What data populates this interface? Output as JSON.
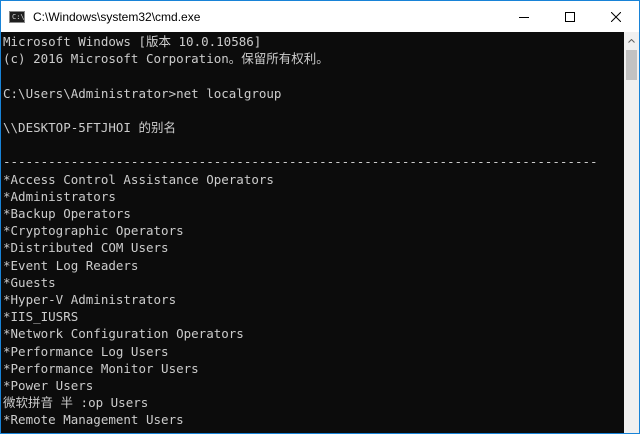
{
  "window": {
    "title": "C:\\Windows\\system32\\cmd.exe",
    "icon_label": "C:\\",
    "controls": [
      "minimize-icon",
      "maximize-icon",
      "close-icon"
    ],
    "border_color": "#1883d7"
  },
  "console": {
    "background": "#0c0c0c",
    "foreground": "#cccccc",
    "lines": [
      "Microsoft Windows [版本 10.0.10586]",
      "(c) 2016 Microsoft Corporation。保留所有权利。",
      "",
      "C:\\Users\\Administrator>net localgroup",
      "",
      "\\\\DESKTOP-5FTJHOI 的别名",
      "",
      "-------------------------------------------------------------------------------",
      "*Access Control Assistance Operators",
      "*Administrators",
      "*Backup Operators",
      "*Cryptographic Operators",
      "*Distributed COM Users",
      "*Event Log Readers",
      "*Guests",
      "*Hyper-V Administrators",
      "*IIS_IUSRS",
      "*Network Configuration Operators",
      "*Performance Log Users",
      "*Performance Monitor Users",
      "*Power Users",
      "微软拼音 半 :op Users",
      "*Remote Management Users"
    ]
  }
}
